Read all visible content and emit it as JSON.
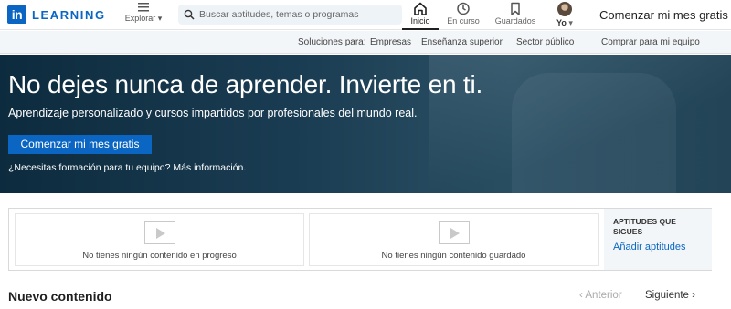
{
  "header": {
    "logo_mark": "in",
    "logo_text": "LEARNING",
    "explore_label": "Explorar",
    "search_placeholder": "Buscar aptitudes, temas o programas",
    "nav": {
      "home": "Inicio",
      "learning": "En curso",
      "saved": "Guardados",
      "me": "Yo"
    },
    "cta": "Comenzar mi mes gratis"
  },
  "subnav": {
    "solutions_label": "Soluciones para:",
    "business": "Empresas",
    "higher_ed": "Enseñanza superior",
    "government": "Sector público",
    "buy_team": "Comprar para mi equipo"
  },
  "hero": {
    "title": "No dejes nunca de aprender. Invierte en ti.",
    "subtitle": "Aprendizaje personalizado y cursos impartidos por profesionales del mundo real.",
    "button": "Comenzar mi mes gratis",
    "team_link": "¿Necesitas formación para tu equipo? Más información."
  },
  "cards": {
    "in_progress": "No tienes ningún contenido en progreso",
    "saved": "No tienes ningún contenido guardado",
    "skills_title": "APTITUDES QUE SIGUES",
    "add_skills": "Añadir aptitudes"
  },
  "new_content": {
    "title": "Nuevo contenido",
    "previous": "‹  Anterior",
    "next": "Siguiente  ›"
  },
  "colors": {
    "brand": "#0a66c2",
    "hero_bg": "#1a3c52"
  }
}
